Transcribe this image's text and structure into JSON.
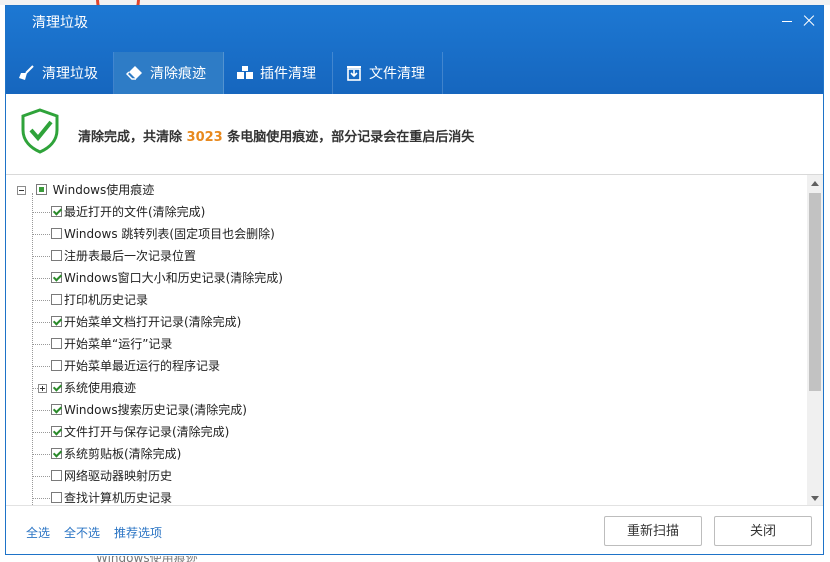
{
  "window": {
    "title": "清理垃圾"
  },
  "tabs": [
    {
      "label": "清理垃圾",
      "icon": "broom-icon",
      "active": false
    },
    {
      "label": "清除痕迹",
      "icon": "eraser-icon",
      "active": true
    },
    {
      "label": "插件清理",
      "icon": "plugin-icon",
      "active": false
    },
    {
      "label": "文件清理",
      "icon": "file-cleanup-icon",
      "active": false
    }
  ],
  "status": {
    "prefix": "清除完成，共清除",
    "count": "3023",
    "suffix": "条电脑使用痕迹，部分记录会在重启后消失",
    "icon": "shield-check-icon"
  },
  "tree": {
    "root": {
      "label": "Windows使用痕迹",
      "state": "partial",
      "expanded": true
    },
    "items": [
      {
        "label": "最近打开的文件(清除完成)",
        "checked": true,
        "level": 1
      },
      {
        "label": "Windows 跳转列表(固定项目也会删除)",
        "checked": false,
        "level": 1
      },
      {
        "label": "注册表最后一次记录位置",
        "checked": false,
        "level": 1
      },
      {
        "label": "Windows窗口大小和历史记录(清除完成)",
        "checked": true,
        "level": 1
      },
      {
        "label": "打印机历史记录",
        "checked": false,
        "level": 1
      },
      {
        "label": "开始菜单文档打开记录(清除完成)",
        "checked": true,
        "level": 1
      },
      {
        "label": "开始菜单“运行”记录",
        "checked": false,
        "level": 1
      },
      {
        "label": "开始菜单最近运行的程序记录",
        "checked": false,
        "level": 1
      },
      {
        "label": "系统使用痕迹",
        "checked": true,
        "level": 1,
        "expandable": true
      },
      {
        "label": "Windows搜索历史记录(清除完成)",
        "checked": true,
        "level": 1
      },
      {
        "label": "文件打开与保存记录(清除完成)",
        "checked": true,
        "level": 1
      },
      {
        "label": "系统剪贴板(清除完成)",
        "checked": true,
        "level": 1
      },
      {
        "label": "网络驱动器映射历史",
        "checked": false,
        "level": 1
      },
      {
        "label": "查找计算机历史记录",
        "checked": false,
        "level": 1
      }
    ]
  },
  "footer": {
    "select_all": "全选",
    "select_none": "全不选",
    "recommended": "推荐选项",
    "rescan": "重新扫描",
    "close": "关闭"
  },
  "colors": {
    "header": "#1a6fc9",
    "accent_count": "#e8891e",
    "link": "#2a74c4",
    "check": "#2a8a2a"
  }
}
